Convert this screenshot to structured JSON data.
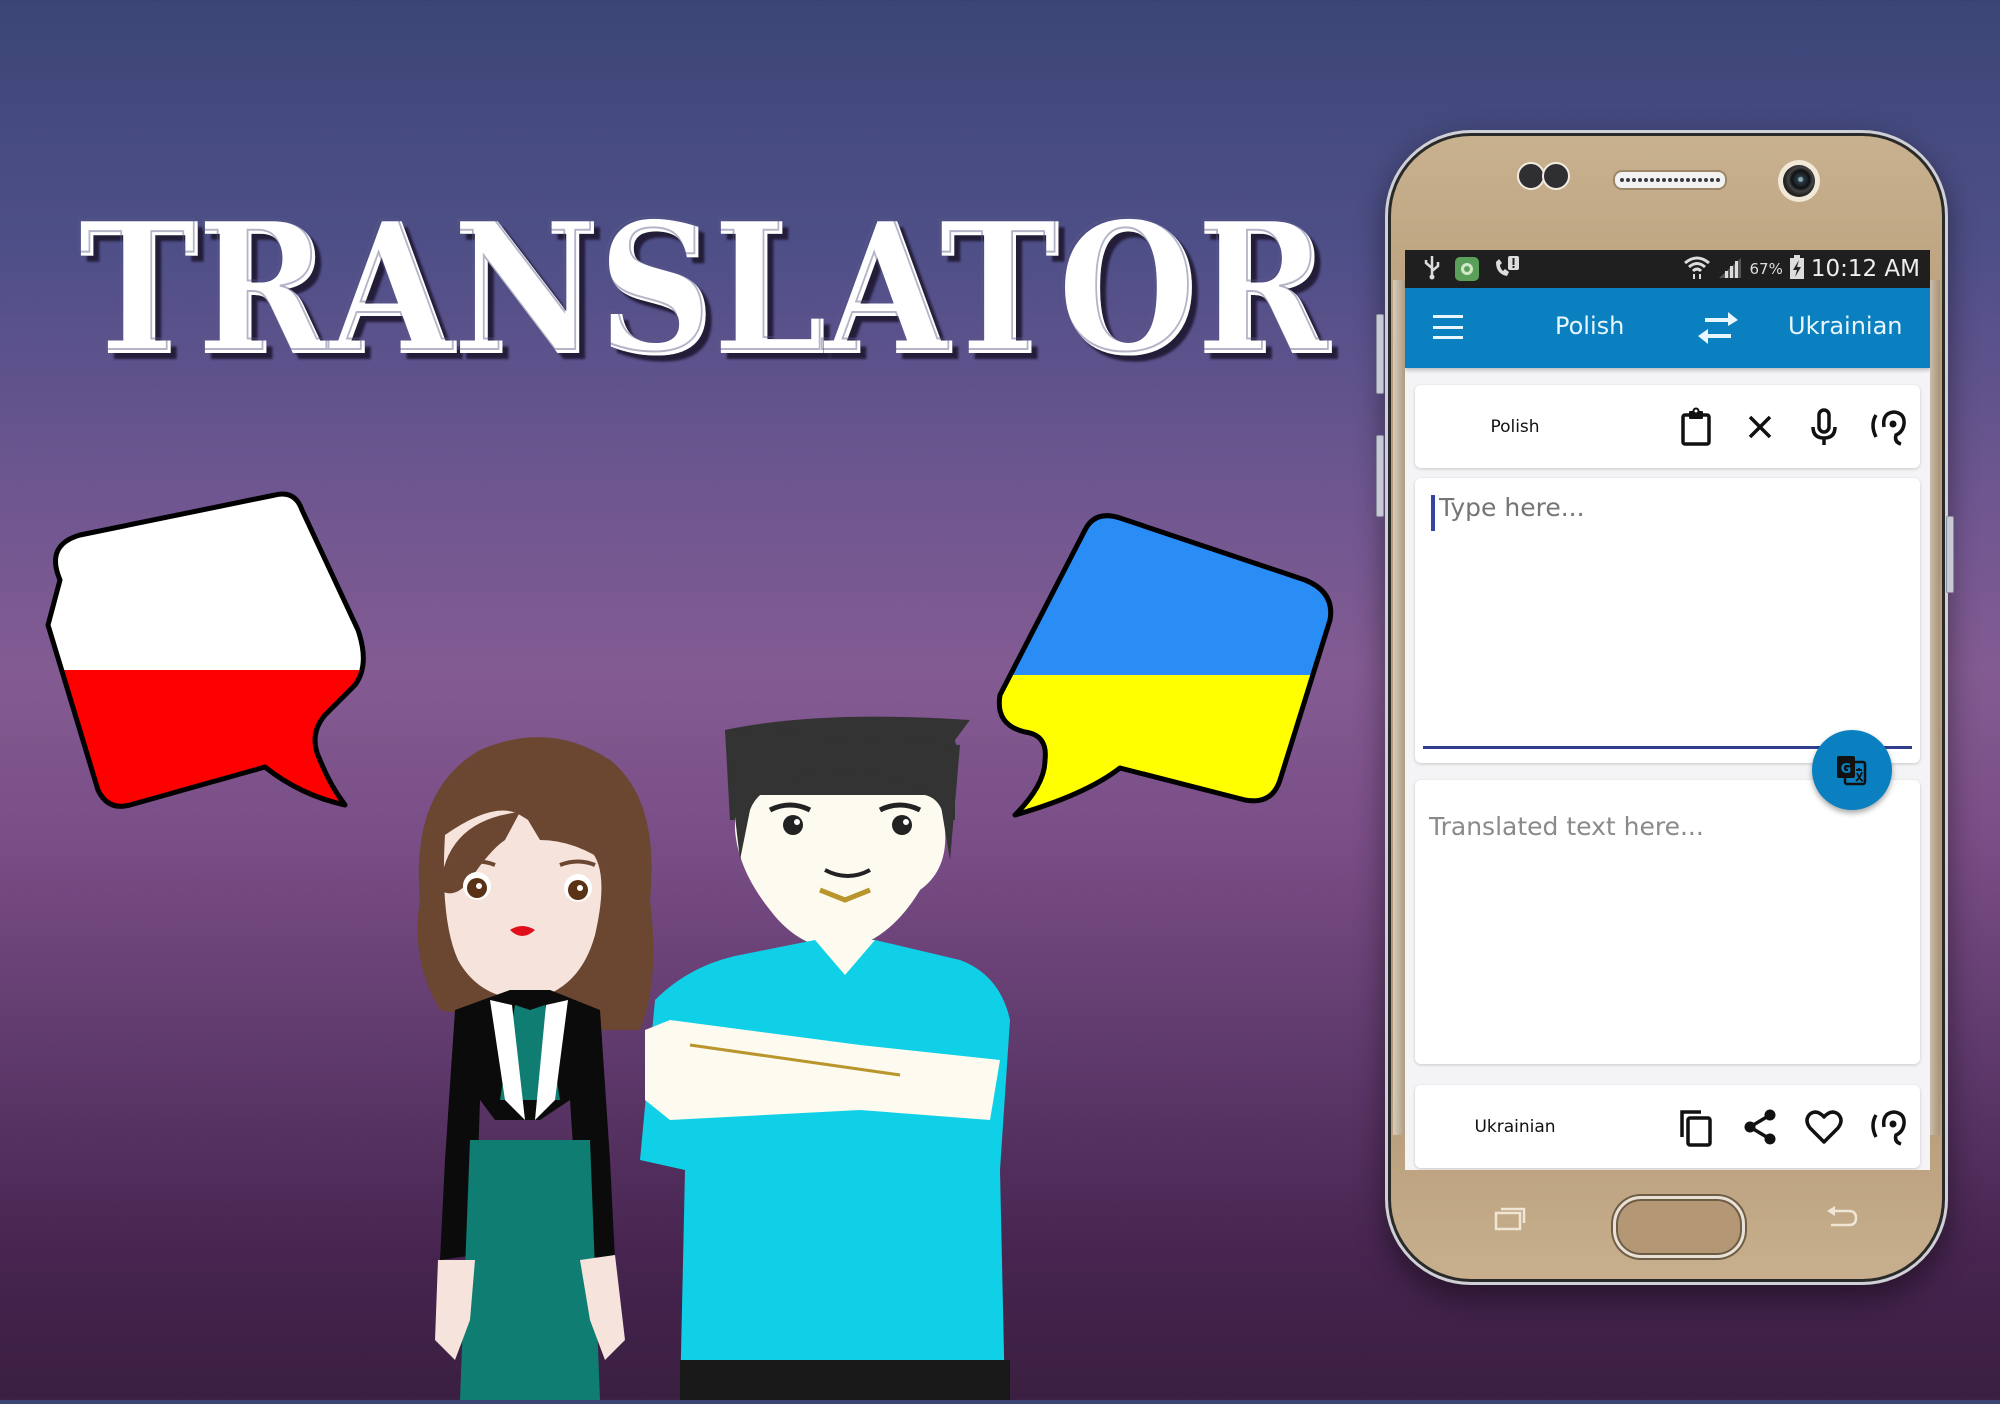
{
  "banner": {
    "title": "TRANSLATOR",
    "source_flag": {
      "name": "Poland",
      "colors": [
        "#ffffff",
        "#ff0000"
      ]
    },
    "target_flag": {
      "name": "Ukraine",
      "colors": [
        "#2a8cf5",
        "#ffff00"
      ]
    }
  },
  "status_bar": {
    "left_icons": [
      "usb-icon",
      "app-notification-icon",
      "missed-call-icon"
    ],
    "right_icons": [
      "wifi-icon",
      "signal-icon",
      "battery-charging-icon"
    ],
    "battery": "67%",
    "time": "10:12 AM"
  },
  "app_bar": {
    "menu_icon": "hamburger-menu-icon",
    "source_language": "Polish",
    "swap_icon": "swap-arrows-icon",
    "target_language": "Ukrainian",
    "color": "#0a80c0"
  },
  "source_toolbar": {
    "language": "Polish",
    "actions": [
      {
        "icon": "clipboard-icon",
        "label": "Paste"
      },
      {
        "icon": "close-icon",
        "label": "Clear"
      },
      {
        "icon": "microphone-icon",
        "label": "Voice input"
      },
      {
        "icon": "ear-icon",
        "label": "Listen"
      }
    ]
  },
  "input": {
    "value": "",
    "placeholder": "Type here..."
  },
  "translate_button": {
    "icon": "google-translate-icon"
  },
  "output": {
    "placeholder": "Translated text here..."
  },
  "target_toolbar": {
    "language": "Ukrainian",
    "actions": [
      {
        "icon": "copy-icon",
        "label": "Copy"
      },
      {
        "icon": "share-icon",
        "label": "Share"
      },
      {
        "icon": "heart-icon",
        "label": "Favorite"
      },
      {
        "icon": "ear-icon",
        "label": "Listen"
      }
    ]
  },
  "nav_keys": [
    "recent-apps-icon",
    "home-button",
    "back-icon"
  ]
}
